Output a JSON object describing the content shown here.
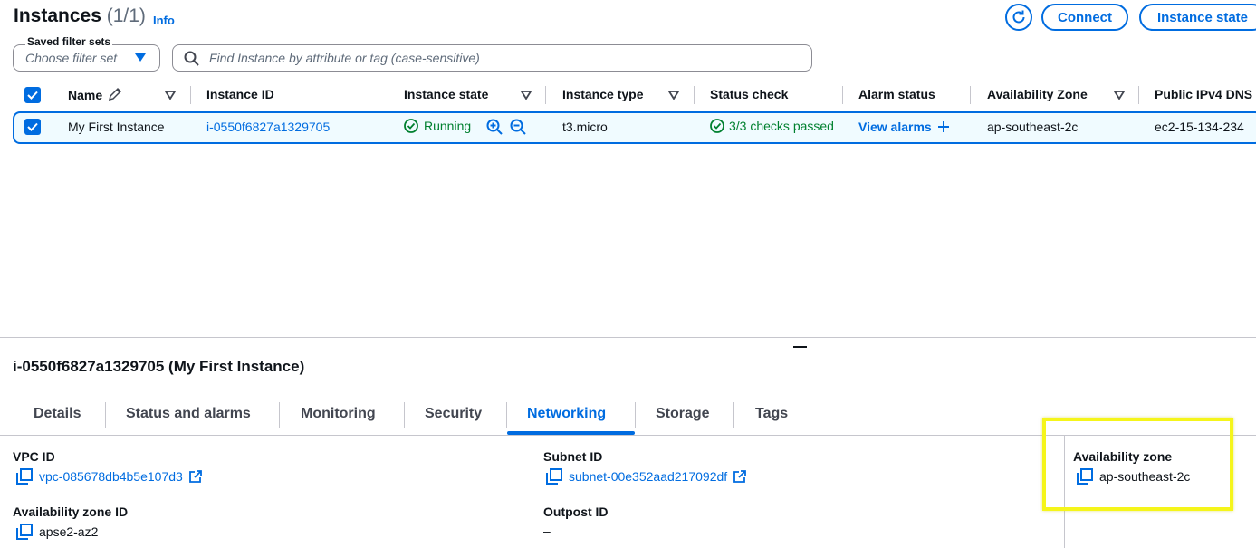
{
  "header": {
    "title": "Instances",
    "count": "(1/1)",
    "info": "Info",
    "connect_label": "Connect",
    "instance_state_label": "Instance state"
  },
  "filters": {
    "saved_label": "Saved filter sets",
    "saved_placeholder": "Choose filter set",
    "search_placeholder": "Find Instance by attribute or tag (case-sensitive)"
  },
  "table": {
    "columns": [
      "Name",
      "Instance ID",
      "Instance state",
      "Instance type",
      "Status check",
      "Alarm status",
      "Availability Zone",
      "Public IPv4 DNS"
    ],
    "row": {
      "name": "My First Instance",
      "instance_id": "i-0550f6827a1329705",
      "state": "Running",
      "type": "t3.micro",
      "status_check": "3/3 checks passed",
      "alarm": "View alarms",
      "az": "ap-southeast-2c",
      "dns": "ec2-15-134-234"
    }
  },
  "details": {
    "title": "i-0550f6827a1329705 (My First Instance)",
    "tabs": [
      "Details",
      "Status and alarms",
      "Monitoring",
      "Security",
      "Networking",
      "Storage",
      "Tags"
    ],
    "active_tab": "Networking",
    "vpc_label": "VPC ID",
    "vpc_value": "vpc-085678db4b5e107d3",
    "az_id_label": "Availability zone ID",
    "az_id_value": "apse2-az2",
    "subnet_label": "Subnet ID",
    "subnet_value": "subnet-00e352aad217092df",
    "outpost_label": "Outpost ID",
    "outpost_value": "–",
    "az_label": "Availability zone",
    "az_value": "ap-southeast-2c"
  },
  "colors": {
    "accent": "#006ce0",
    "success": "#00802f",
    "highlight": "#f5f51a"
  }
}
